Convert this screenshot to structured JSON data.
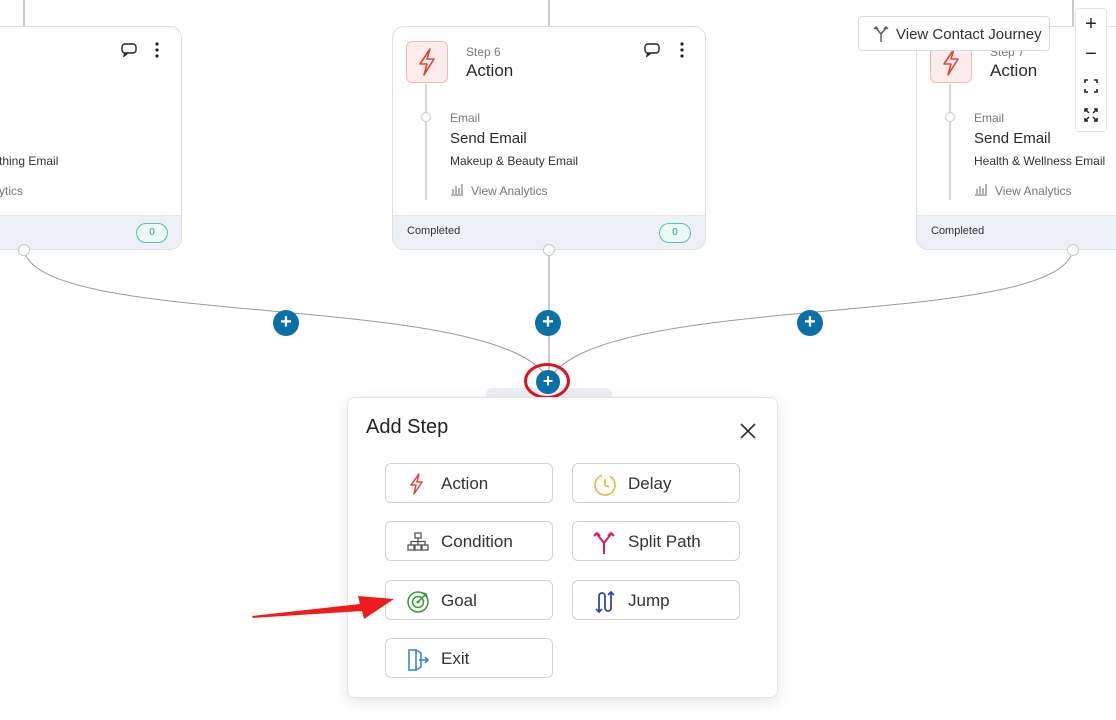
{
  "toolbar": {
    "view_journey": "View Contact Journey",
    "zoom_in": "+",
    "zoom_out": "−"
  },
  "cards": [
    {
      "email_name": "thing Email",
      "analytics": "ytics",
      "badge": "0"
    },
    {
      "step": "Step 6",
      "type": "Action",
      "channel": "Email",
      "action": "Send Email",
      "email_name": "Makeup & Beauty Email",
      "analytics": "View Analytics",
      "status": "Completed",
      "badge": "0"
    },
    {
      "step": "Step 7",
      "type": "Action",
      "channel": "Email",
      "action": "Send Email",
      "email_name": "Health & Wellness Email",
      "analytics": "View Analytics",
      "status": "Completed"
    }
  ],
  "add_step": {
    "title": "Add Step",
    "options": [
      {
        "label": "Action",
        "icon": "lightning-icon",
        "color": "#e0433a"
      },
      {
        "label": "Delay",
        "icon": "clock-icon",
        "color": "#f2b233"
      },
      {
        "label": "Condition",
        "icon": "hierarchy-icon",
        "color": "#555555"
      },
      {
        "label": "Split Path",
        "icon": "split-icon",
        "color": "#d81b60"
      },
      {
        "label": "Goal",
        "icon": "target-icon",
        "color": "#3a9a3a"
      },
      {
        "label": "Jump",
        "icon": "jump-icon",
        "color": "#3346b0"
      },
      {
        "label": "Exit",
        "icon": "exit-icon",
        "color": "#2f80d1"
      }
    ]
  },
  "colors": {
    "accent": "#0d6fa8",
    "highlight": "#e0131b",
    "arrow": "#ee1c1c"
  }
}
